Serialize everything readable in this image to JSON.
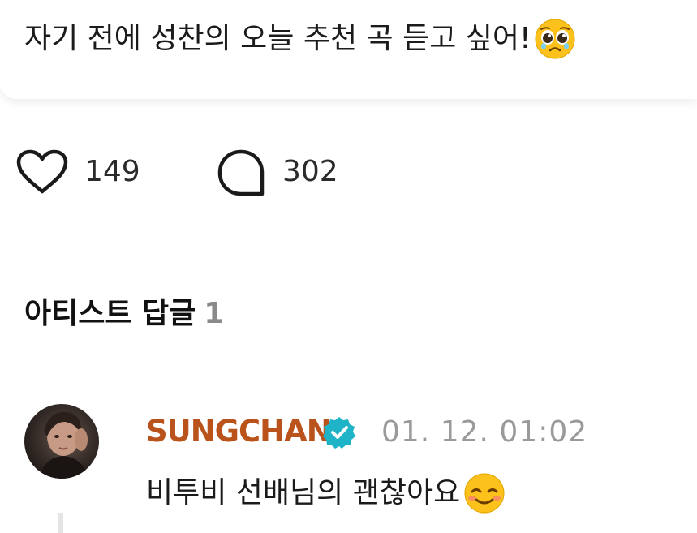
{
  "post": {
    "text": "자기 전에 성찬의 오늘 추천 곡 듣고 싶어!",
    "emoji_icon": "pleading-face-emoji"
  },
  "actions": {
    "like_icon": "heart-icon",
    "like_count": "149",
    "comment_icon": "comment-bubble-icon",
    "comment_count": "302"
  },
  "artist_replies": {
    "title": "아티스트 답글",
    "count": "1"
  },
  "reply": {
    "author": "SUNGCHAN",
    "verified_icon": "verified-badge-icon",
    "timestamp": "01. 12. 01:02",
    "text": "비투비 선배님의 괜찮아요",
    "emoji_icon": "smiling-face-emoji"
  },
  "colors": {
    "author_name": "#b9531b",
    "verified_badge": "#1fb3c8",
    "muted_text": "#9a9a9a"
  }
}
